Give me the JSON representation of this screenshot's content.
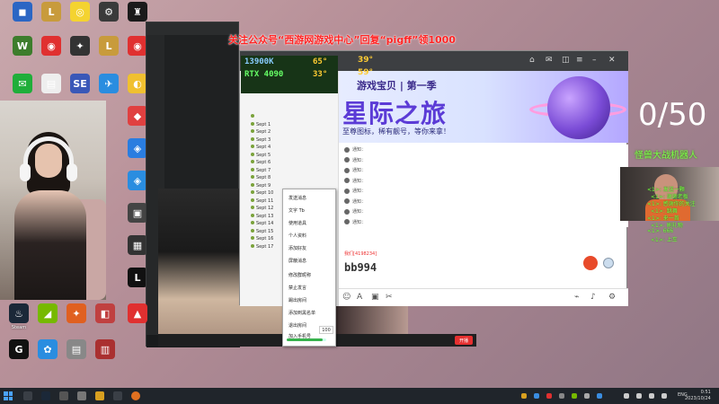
{
  "desktop_icons": [
    {
      "label": "",
      "color": "#2b66c4",
      "glyph": "◼"
    },
    {
      "label": "",
      "color": "#c89b3c",
      "glyph": "L"
    },
    {
      "label": "",
      "color": "#f4d330",
      "glyph": "◎"
    },
    {
      "label": "",
      "color": "#3a3a3a",
      "glyph": "⚙"
    },
    {
      "label": "",
      "color": "#1a1a1a",
      "glyph": "♜"
    },
    {
      "label": "",
      "color": "#3d7d2c",
      "glyph": "W"
    },
    {
      "label": "",
      "color": "#e03030",
      "glyph": "◉"
    },
    {
      "label": "",
      "color": "#333",
      "glyph": "✦"
    },
    {
      "label": "",
      "color": "#c89b3c",
      "glyph": "L"
    },
    {
      "label": "",
      "color": "#e03030",
      "glyph": "◉"
    },
    {
      "label": "",
      "color": "#1fae3a",
      "glyph": "✉"
    },
    {
      "label": "",
      "color": "#eeeeee",
      "glyph": "▤"
    },
    {
      "label": "",
      "color": "#3a58b8",
      "glyph": "SE"
    },
    {
      "label": "",
      "color": "#2a8de0",
      "glyph": "✈"
    },
    {
      "label": "",
      "color": "#3a8de0",
      "glyph": "◎"
    },
    {
      "label": "",
      "color": "#f0c030",
      "glyph": "◐"
    },
    {
      "label": "",
      "color": "#e04040",
      "glyph": "◆"
    },
    {
      "label": "",
      "color": "#2a7de0",
      "glyph": "◈"
    },
    {
      "label": "",
      "color": "#2a8de0",
      "glyph": "◈"
    },
    {
      "label": "",
      "color": "#444",
      "glyph": "▣"
    },
    {
      "label": "",
      "color": "#333",
      "glyph": "▦"
    },
    {
      "label": "",
      "color": "#111",
      "glyph": "L"
    }
  ],
  "bottom_icons": [
    {
      "label": "Steam",
      "color": "#1b2838",
      "glyph": "♨"
    },
    {
      "label": "",
      "color": "#76b900",
      "glyph": "◢"
    },
    {
      "label": "",
      "color": "#e06020",
      "glyph": "✦"
    },
    {
      "label": "",
      "color": "#c04040",
      "glyph": "◧"
    },
    {
      "label": "",
      "color": "#e03030",
      "glyph": "▲"
    },
    {
      "label": "",
      "color": "#111",
      "glyph": "G"
    },
    {
      "label": "",
      "color": "#2a8de0",
      "glyph": "✿"
    },
    {
      "label": "",
      "color": "#888",
      "glyph": "▤"
    },
    {
      "label": "",
      "color": "#aa3030",
      "glyph": "▥"
    }
  ],
  "notice": "关注公众号“西游网游戏中心”回复“pigff”领1000",
  "stats": {
    "gpu_model": "RTX 4090",
    "cpu_label": "13900K",
    "temp1": "65°",
    "temp2": "39°",
    "temp3": "33°",
    "temp4": "59°"
  },
  "banner": {
    "line1": "游戏宝贝  |  第一季",
    "title": "星际之旅",
    "subtitle": "至尊图标，稀有靓号，等你来拿！"
  },
  "tree_rows": [
    "",
    "Sept 1",
    "Sept 2",
    "Sept 3",
    "Sept 4",
    "Sept 5",
    "Sept 6",
    "Sept 7",
    "Sept 8",
    "Sept 9",
    "Sept 10",
    "Sept 11",
    "Sept 12",
    "Sept 13",
    "Sept 14",
    "Sept 15",
    "Sept 16",
    "Sept 17"
  ],
  "messages": [
    "通知：",
    "通知：",
    "通知：",
    "通知：",
    "通知：",
    "通知：",
    "通知：",
    "通知："
  ],
  "nameplate": "我们[4198234]",
  "bigname": "bb994",
  "context_menu": [
    "发送消息",
    "文字 Tb",
    "使用道具",
    "个人资料",
    "添加好友",
    "屏蔽消息",
    "修改群昵称",
    "禁止发言",
    "踢出房间",
    "添加到黑名单",
    "退出房间",
    "加入手机号"
  ],
  "context_slider_value": "100",
  "stream_button": "开播",
  "counter": "0/50",
  "dance_text": "怪兽大战机器人",
  "green_lines": [
    "<1>: 发送一颗",
    "<1>: 谢谢老板",
    "<1>: 感谢你的关注",
    "<1>: 跳舞",
    "<1>: 来一首",
    "<1>: 刷礼物",
    "<1>: 666",
    "<1>: 上车"
  ],
  "clock": {
    "time": "0:51",
    "date": "2023/10/24"
  },
  "lang": "ENG"
}
